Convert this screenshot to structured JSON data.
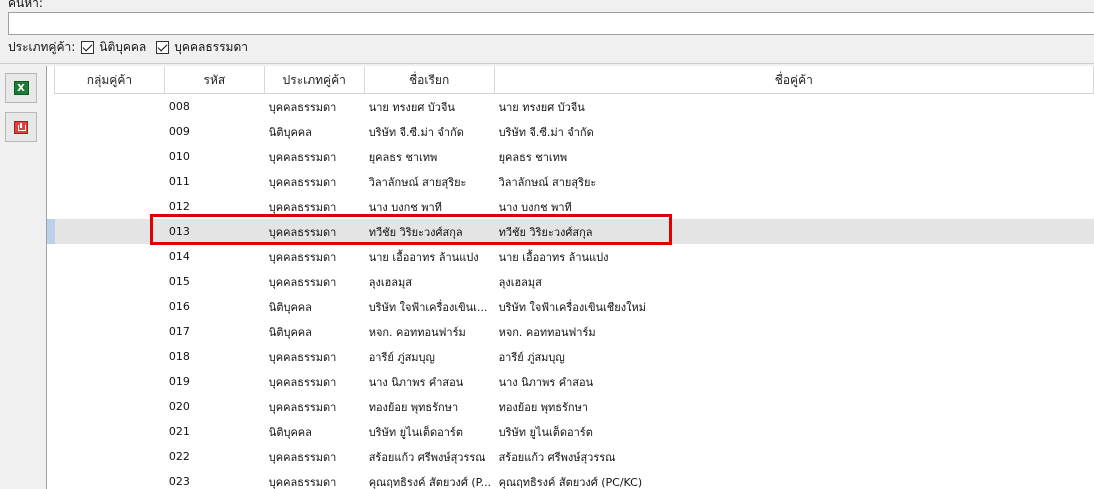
{
  "search": {
    "label": "ค้นหา:",
    "value": "",
    "placeholder": ""
  },
  "filter": {
    "label": "ประเภทคู่ค้า:",
    "options": [
      {
        "label": "นิติบุคคล",
        "checked": true
      },
      {
        "label": "บุคคลธรรมดา",
        "checked": true
      }
    ]
  },
  "toolbar": {
    "excel_icon": "excel-icon",
    "export_icon": "export-icon"
  },
  "table": {
    "columns": [
      "กลุ่มคู่ค้า",
      "รหัส",
      "ประเภทคู่ค้า",
      "ชื่อเรียก",
      "ชื่อคู่ค้า"
    ],
    "selected_row": 5,
    "rows": [
      {
        "group": "",
        "code": "008",
        "type": "บุคคลธรรมดา",
        "short": "นาย ทรงยศ บัวจีน",
        "name": "นาย ทรงยศ บัวจีน"
      },
      {
        "group": "",
        "code": "009",
        "type": "นิติบุคคล",
        "short": "บริษัท จี.ซี.ม่า จำกัด",
        "name": "บริษัท จี.ซี.ม่า จำกัด"
      },
      {
        "group": "",
        "code": "010",
        "type": "บุคคลธรรมดา",
        "short": "ยุคลธร ชาเทพ",
        "name": "ยุคลธร ชาเทพ"
      },
      {
        "group": "",
        "code": "011",
        "type": "บุคคลธรรมดา",
        "short": "วิลาลักษณ์ สายสุริยะ",
        "name": "วิลาลักษณ์ สายสุริยะ"
      },
      {
        "group": "",
        "code": "012",
        "type": "บุคคลธรรมดา",
        "short": "นาง บงกช พาที",
        "name": "นาง บงกช พาที"
      },
      {
        "group": "",
        "code": "013",
        "type": "บุคคลธรรมดา",
        "short": "ทวีชัย วิริยะวงศ์สกุล",
        "name": "ทวีชัย วิริยะวงศ์สกุล"
      },
      {
        "group": "",
        "code": "014",
        "type": "บุคคลธรรมดา",
        "short": "นาย เอื้ออาทร ล้านแปง",
        "name": "นาย เอื้ออาทร ล้านแปง"
      },
      {
        "group": "",
        "code": "015",
        "type": "บุคคลธรรมดา",
        "short": "ลุงเฮลมุส",
        "name": "ลุงเฮลมุส"
      },
      {
        "group": "",
        "code": "016",
        "type": "นิติบุคคล",
        "short": "บริษัท ใจฟ้าเครื่องเขินเ...",
        "name": "บริษัท ใจฟ้าเครื่องเขินเชียงใหม่"
      },
      {
        "group": "",
        "code": "017",
        "type": "นิติบุคคล",
        "short": "หจก. คอททอนฟาร์ม",
        "name": "หจก. คอททอนฟาร์ม"
      },
      {
        "group": "",
        "code": "018",
        "type": "บุคคลธรรมดา",
        "short": "อารีย์ ภู่สมบุญ",
        "name": "อารีย์ ภู่สมบุญ"
      },
      {
        "group": "",
        "code": "019",
        "type": "บุคคลธรรมดา",
        "short": "นาง นิภาพร คำสอน",
        "name": "นาง นิภาพร คำสอน"
      },
      {
        "group": "",
        "code": "020",
        "type": "บุคคลธรรมดา",
        "short": "ทองย้อย พุทธรักษา",
        "name": "ทองย้อย พุทธรักษา"
      },
      {
        "group": "",
        "code": "021",
        "type": "นิติบุคคล",
        "short": "บริษัท ยูไนเต็ดอาร์ต",
        "name": "บริษัท ยูไนเต็ดอาร์ต"
      },
      {
        "group": "",
        "code": "022",
        "type": "บุคคลธรรมดา",
        "short": "สร้อยแก้ว ศรีพงษ์สุวรรณ",
        "name": "สร้อยแก้ว ศรีพงษ์สุวรรณ"
      },
      {
        "group": "",
        "code": "023",
        "type": "บุคคลธรรมดา",
        "short": "คุณฤทธิรงค์ สัตยวงศ์ (P...",
        "name": "คุณฤทธิรงค์ สัตยวงศ์ (PC/KC)"
      }
    ]
  },
  "colors": {
    "highlight": "#e00000",
    "selected_row": "#e4e4e4",
    "row_indicator": "#b9d1ea"
  }
}
